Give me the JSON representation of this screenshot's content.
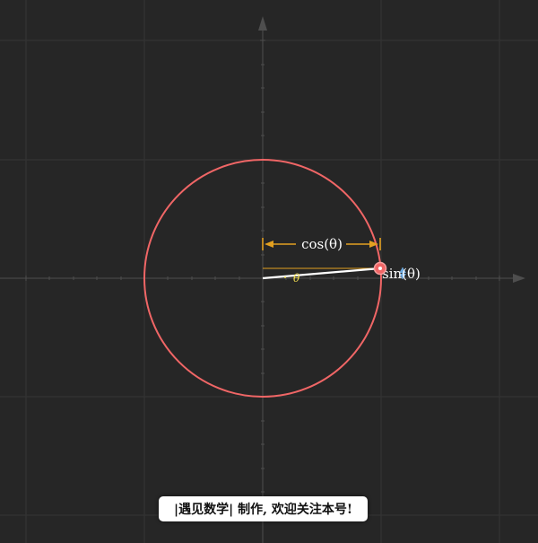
{
  "labels": {
    "cos": "cos(θ)",
    "sin": "sin(θ)",
    "theta": "θ"
  },
  "caption": "|遇见数学| 制作, 欢迎关注本号!",
  "colors": {
    "background": "#262626",
    "circle": "#f06666",
    "cos_bracket": "#e3a020",
    "radius": "#ffffff",
    "angle": "#f5e050",
    "sin_marker": "#6fa8dc",
    "point": "#f06666",
    "grid": "#3a3a3a",
    "axis": "#555555"
  },
  "diagram": {
    "unit_circle_radius": 1,
    "theta_degrees": 5
  }
}
